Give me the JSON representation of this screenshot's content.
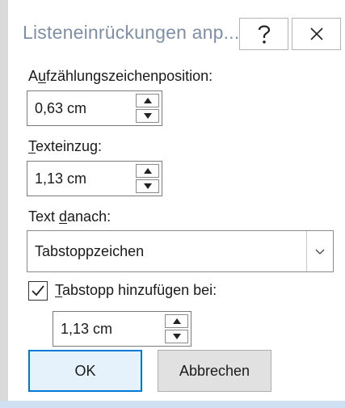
{
  "dialog": {
    "title": "Listeneinrückungen anp...",
    "help_icon": "help-icon",
    "close_icon": "close-icon"
  },
  "bullet_position": {
    "label_accel": "u",
    "label_pre": "A",
    "label_post": "fzählungszeichenposition:",
    "value": "0,63 cm"
  },
  "text_indent": {
    "label_accel": "T",
    "label_post": "exteinzug:",
    "value": "1,13 cm"
  },
  "follow_number": {
    "label_pre": "Text ",
    "label_accel": "d",
    "label_post": "anach:",
    "selected": "Tabstoppzeichen"
  },
  "add_tab_stop": {
    "checked": true,
    "label_accel": "T",
    "label_post": "abstopp hinzufügen bei:",
    "value": "1,13 cm"
  },
  "buttons": {
    "ok": "OK",
    "cancel": "Abbrechen"
  },
  "colors": {
    "title_text": "#7e8fa6",
    "ok_border": "#0078d7",
    "ok_fill": "#e5f1fb"
  }
}
